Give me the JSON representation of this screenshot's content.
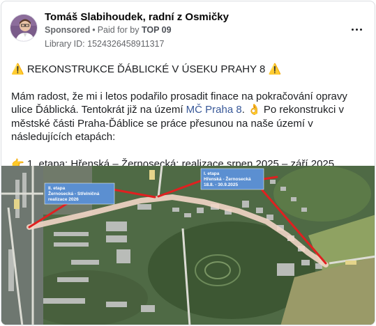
{
  "header": {
    "page_name": "Tomáš Slabihoudek, radní z Osmičky",
    "sponsored": "Sponsored",
    "separator": "•",
    "paid_for_by": "Paid for by",
    "funder": "TOP 09",
    "library_id": "Library ID: 1524326458911317",
    "more_icon": "more-options-icon"
  },
  "post": {
    "headline": "⚠️ REKONSTRUKCE ĎÁBLICKÉ V ÚSEKU PRAHY 8 ⚠️",
    "para1_start": "Mám radost, že mi i letos podařilo prosadit finace na pokračování opravy ulice Ďáblická. Tentokrát již na území ",
    "para1_link": "MČ Praha 8",
    "para1_end": ". 👌 Po rekonstrukci v městské části Praha-Ďáblice se práce přesunou na naše území v následujících etapách:",
    "item1": "👉 1. etapa: Hřenská – Žernosecká: realizace srpen 2025 – září 2025…"
  },
  "map": {
    "label_right": {
      "line1": "I. etapa",
      "line2": "Hřenská - Žernosecká",
      "line3": "18.8. - 30.9.2025"
    },
    "label_left": {
      "line1": "II. etapa",
      "line2": "Žernosecká - Střelničná",
      "line3": "realizace 2026"
    },
    "colors": {
      "label_bg": "#5b8fd1",
      "arrow": "#e02020",
      "route": "#f2d6c6"
    }
  }
}
